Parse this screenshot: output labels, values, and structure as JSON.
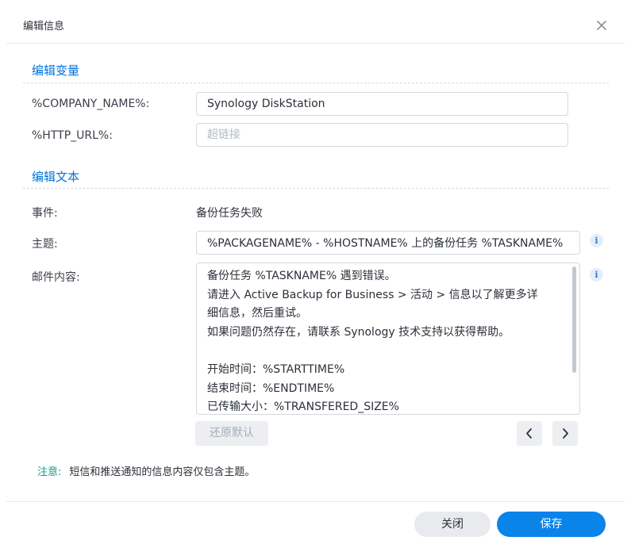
{
  "dialog": {
    "title": "编辑信息",
    "close_icon": "close-icon"
  },
  "variables_section": {
    "title": "编辑变量",
    "company_name": {
      "label": "%COMPANY_NAME%:",
      "value": "Synology DiskStation"
    },
    "http_url": {
      "label": "%HTTP_URL%:",
      "value": "",
      "placeholder": "超链接"
    }
  },
  "text_section": {
    "title": "编辑文本",
    "event": {
      "label": "事件:",
      "value": "备份任务失败"
    },
    "subject": {
      "label": "主题:",
      "value": "%PACKAGENAME% - %HOSTNAME% 上的备份任务 %TASKNAME%",
      "icon": "info-icon"
    },
    "body": {
      "label": "邮件内容:",
      "icon": "info-icon",
      "value": "备份任务 %TASKNAME% 遇到错误。\n请进入 Active Backup for Business > 活动 > 信息以了解更多详\n细信息，然后重试。\n如果问题仍然存在，请联系 Synology 技术支持以获得帮助。\n\n开始时间：%STARTTIME%\n结束时间：%ENDTIME%\n已传输大小：%TRANSFERED_SIZE%"
    },
    "restore_default_label": "还原默认",
    "prev_icon": "chevron-left-icon",
    "next_icon": "chevron-right-icon"
  },
  "note": {
    "key": "注意:",
    "text": "短信和推送通知的信息内容仅包含主题。"
  },
  "footer": {
    "cancel_label": "关闭",
    "save_label": "保存"
  },
  "colors": {
    "accent": "#0074d9",
    "primary_button": "#0a84e9",
    "note_key": "#0e9e88"
  }
}
